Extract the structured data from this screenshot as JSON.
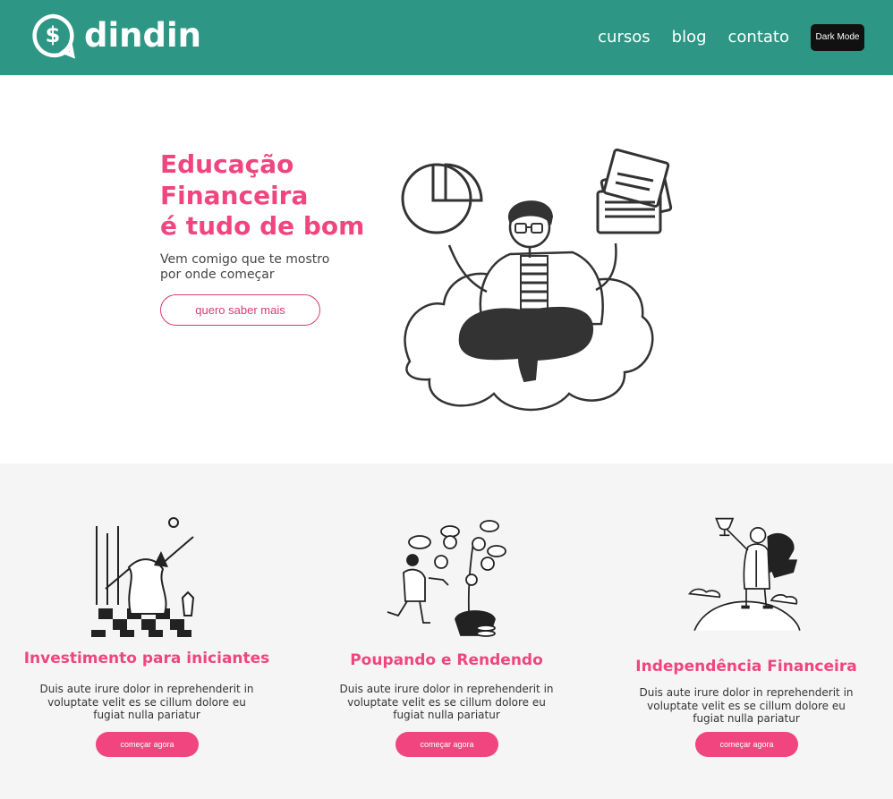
{
  "header": {
    "brand": "dindin",
    "nav": [
      {
        "label": "cursos"
      },
      {
        "label": "blog"
      },
      {
        "label": "contato"
      }
    ],
    "dark_mode_label": "Dark Mode"
  },
  "hero": {
    "title_lines": [
      "Educação",
      "Financeira",
      "é tudo de bom"
    ],
    "subtitle": "Vem comigo que te mostro por onde começar",
    "cta_label": "quero saber mais"
  },
  "cards": [
    {
      "title": "Investimento para iniciantes",
      "text": "Duis aute irure dolor in reprehenderit in voluptate velit es se cillum dolore eu fugiat nulla pariatur",
      "button": "começar agora"
    },
    {
      "title": "Poupando e Rendendo",
      "text": "Duis aute irure dolor in reprehenderit in voluptate velit es se cillum dolore eu fugiat nulla pariatur",
      "button": "começar agora"
    },
    {
      "title": "Independência Financeira",
      "text": "Duis aute irure dolor in reprehenderit in voluptate velit es se cillum dolore eu fugiat nulla pariatur",
      "button": "começar agora"
    }
  ],
  "colors": {
    "header_bg": "#2e9684",
    "accent": "#f0457f",
    "features_bg": "#f5f5f5"
  },
  "icons": {
    "logo": "dollar-chat-icon"
  }
}
